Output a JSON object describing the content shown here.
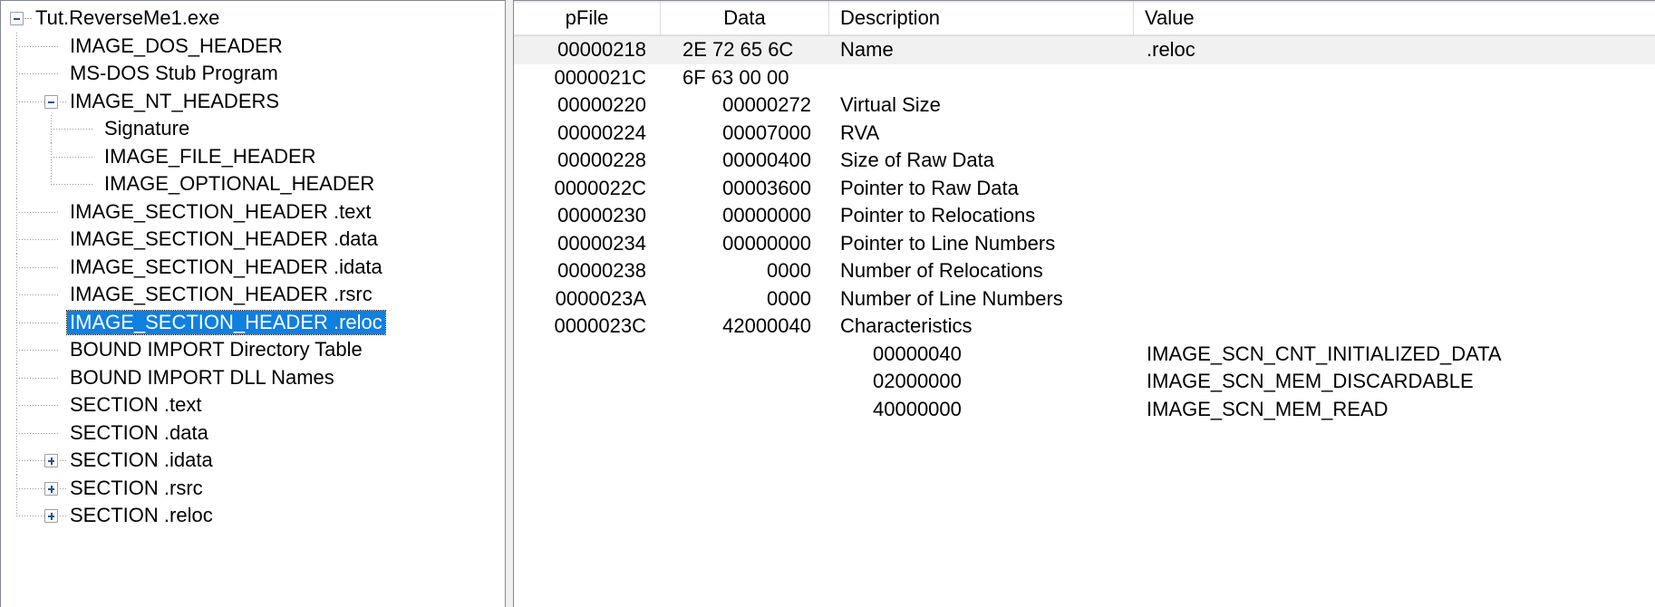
{
  "tree": {
    "name": "pe-structure-tree",
    "items": [
      {
        "label": "Tut.ReverseMe1.exe",
        "depth": 0,
        "toggle": "minus",
        "selected": false
      },
      {
        "label": "IMAGE_DOS_HEADER",
        "depth": 1,
        "toggle": "none",
        "selected": false
      },
      {
        "label": "MS-DOS Stub Program",
        "depth": 1,
        "toggle": "none",
        "selected": false
      },
      {
        "label": "IMAGE_NT_HEADERS",
        "depth": 1,
        "toggle": "minus",
        "selected": false
      },
      {
        "label": "Signature",
        "depth": 2,
        "toggle": "none",
        "selected": false
      },
      {
        "label": "IMAGE_FILE_HEADER",
        "depth": 2,
        "toggle": "none",
        "selected": false
      },
      {
        "label": "IMAGE_OPTIONAL_HEADER",
        "depth": 2,
        "toggle": "none",
        "selected": false
      },
      {
        "label": "IMAGE_SECTION_HEADER .text",
        "depth": 1,
        "toggle": "none",
        "selected": false
      },
      {
        "label": "IMAGE_SECTION_HEADER .data",
        "depth": 1,
        "toggle": "none",
        "selected": false
      },
      {
        "label": "IMAGE_SECTION_HEADER .idata",
        "depth": 1,
        "toggle": "none",
        "selected": false
      },
      {
        "label": "IMAGE_SECTION_HEADER .rsrc",
        "depth": 1,
        "toggle": "none",
        "selected": false
      },
      {
        "label": "IMAGE_SECTION_HEADER .reloc",
        "depth": 1,
        "toggle": "none",
        "selected": true
      },
      {
        "label": "BOUND IMPORT Directory Table",
        "depth": 1,
        "toggle": "none",
        "selected": false
      },
      {
        "label": "BOUND IMPORT DLL Names",
        "depth": 1,
        "toggle": "none",
        "selected": false
      },
      {
        "label": "SECTION .text",
        "depth": 1,
        "toggle": "none",
        "selected": false
      },
      {
        "label": "SECTION .data",
        "depth": 1,
        "toggle": "none",
        "selected": false
      },
      {
        "label": "SECTION .idata",
        "depth": 1,
        "toggle": "plus",
        "selected": false
      },
      {
        "label": "SECTION .rsrc",
        "depth": 1,
        "toggle": "plus",
        "selected": false
      },
      {
        "label": "SECTION .reloc",
        "depth": 1,
        "toggle": "plus",
        "selected": false
      }
    ]
  },
  "list": {
    "name": "section-header-fields-list",
    "columns": [
      {
        "key": "pfile",
        "label": "pFile"
      },
      {
        "key": "data",
        "label": "Data"
      },
      {
        "key": "description",
        "label": "Description"
      },
      {
        "key": "value",
        "label": "Value"
      }
    ],
    "rows": [
      {
        "pfile": "00000218",
        "data": "2E 72 65 6C",
        "data_style": "hex",
        "description": "Name",
        "value": ".reloc",
        "alt": true
      },
      {
        "pfile": "0000021C",
        "data": "6F 63 00 00",
        "data_style": "hex",
        "description": "",
        "value": "",
        "alt": false
      },
      {
        "pfile": "00000220",
        "data": "00000272",
        "data_style": "num",
        "description": "Virtual Size",
        "value": "",
        "alt": false
      },
      {
        "pfile": "00000224",
        "data": "00007000",
        "data_style": "num",
        "description": "RVA",
        "value": "",
        "alt": false
      },
      {
        "pfile": "00000228",
        "data": "00000400",
        "data_style": "num",
        "description": "Size of Raw Data",
        "value": "",
        "alt": false
      },
      {
        "pfile": "0000022C",
        "data": "00003600",
        "data_style": "num",
        "description": "Pointer to Raw Data",
        "value": "",
        "alt": false
      },
      {
        "pfile": "00000230",
        "data": "00000000",
        "data_style": "num",
        "description": "Pointer to Relocations",
        "value": "",
        "alt": false
      },
      {
        "pfile": "00000234",
        "data": "00000000",
        "data_style": "num",
        "description": "Pointer to Line Numbers",
        "value": "",
        "alt": false
      },
      {
        "pfile": "00000238",
        "data": "0000",
        "data_style": "num",
        "description": "Number of Relocations",
        "value": "",
        "alt": false
      },
      {
        "pfile": "0000023A",
        "data": "0000",
        "data_style": "num",
        "description": "Number of Line Numbers",
        "value": "",
        "alt": false
      },
      {
        "pfile": "0000023C",
        "data": "42000040",
        "data_style": "num",
        "description": "Characteristics",
        "value": "",
        "alt": false
      },
      {
        "pfile": "",
        "data": "",
        "data_style": "num",
        "description": "00000040",
        "desc_indent": true,
        "value": "IMAGE_SCN_CNT_INITIALIZED_DATA",
        "alt": false
      },
      {
        "pfile": "",
        "data": "",
        "data_style": "num",
        "description": "02000000",
        "desc_indent": true,
        "value": "IMAGE_SCN_MEM_DISCARDABLE",
        "alt": false
      },
      {
        "pfile": "",
        "data": "",
        "data_style": "num",
        "description": "40000000",
        "desc_indent": true,
        "value": "IMAGE_SCN_MEM_READ",
        "alt": false
      }
    ]
  },
  "colors": {
    "selection": "#0f7fe0",
    "alt_row": "#f1f1f1",
    "panel_border": "#828790",
    "window_bg": "#f0f0f0"
  }
}
